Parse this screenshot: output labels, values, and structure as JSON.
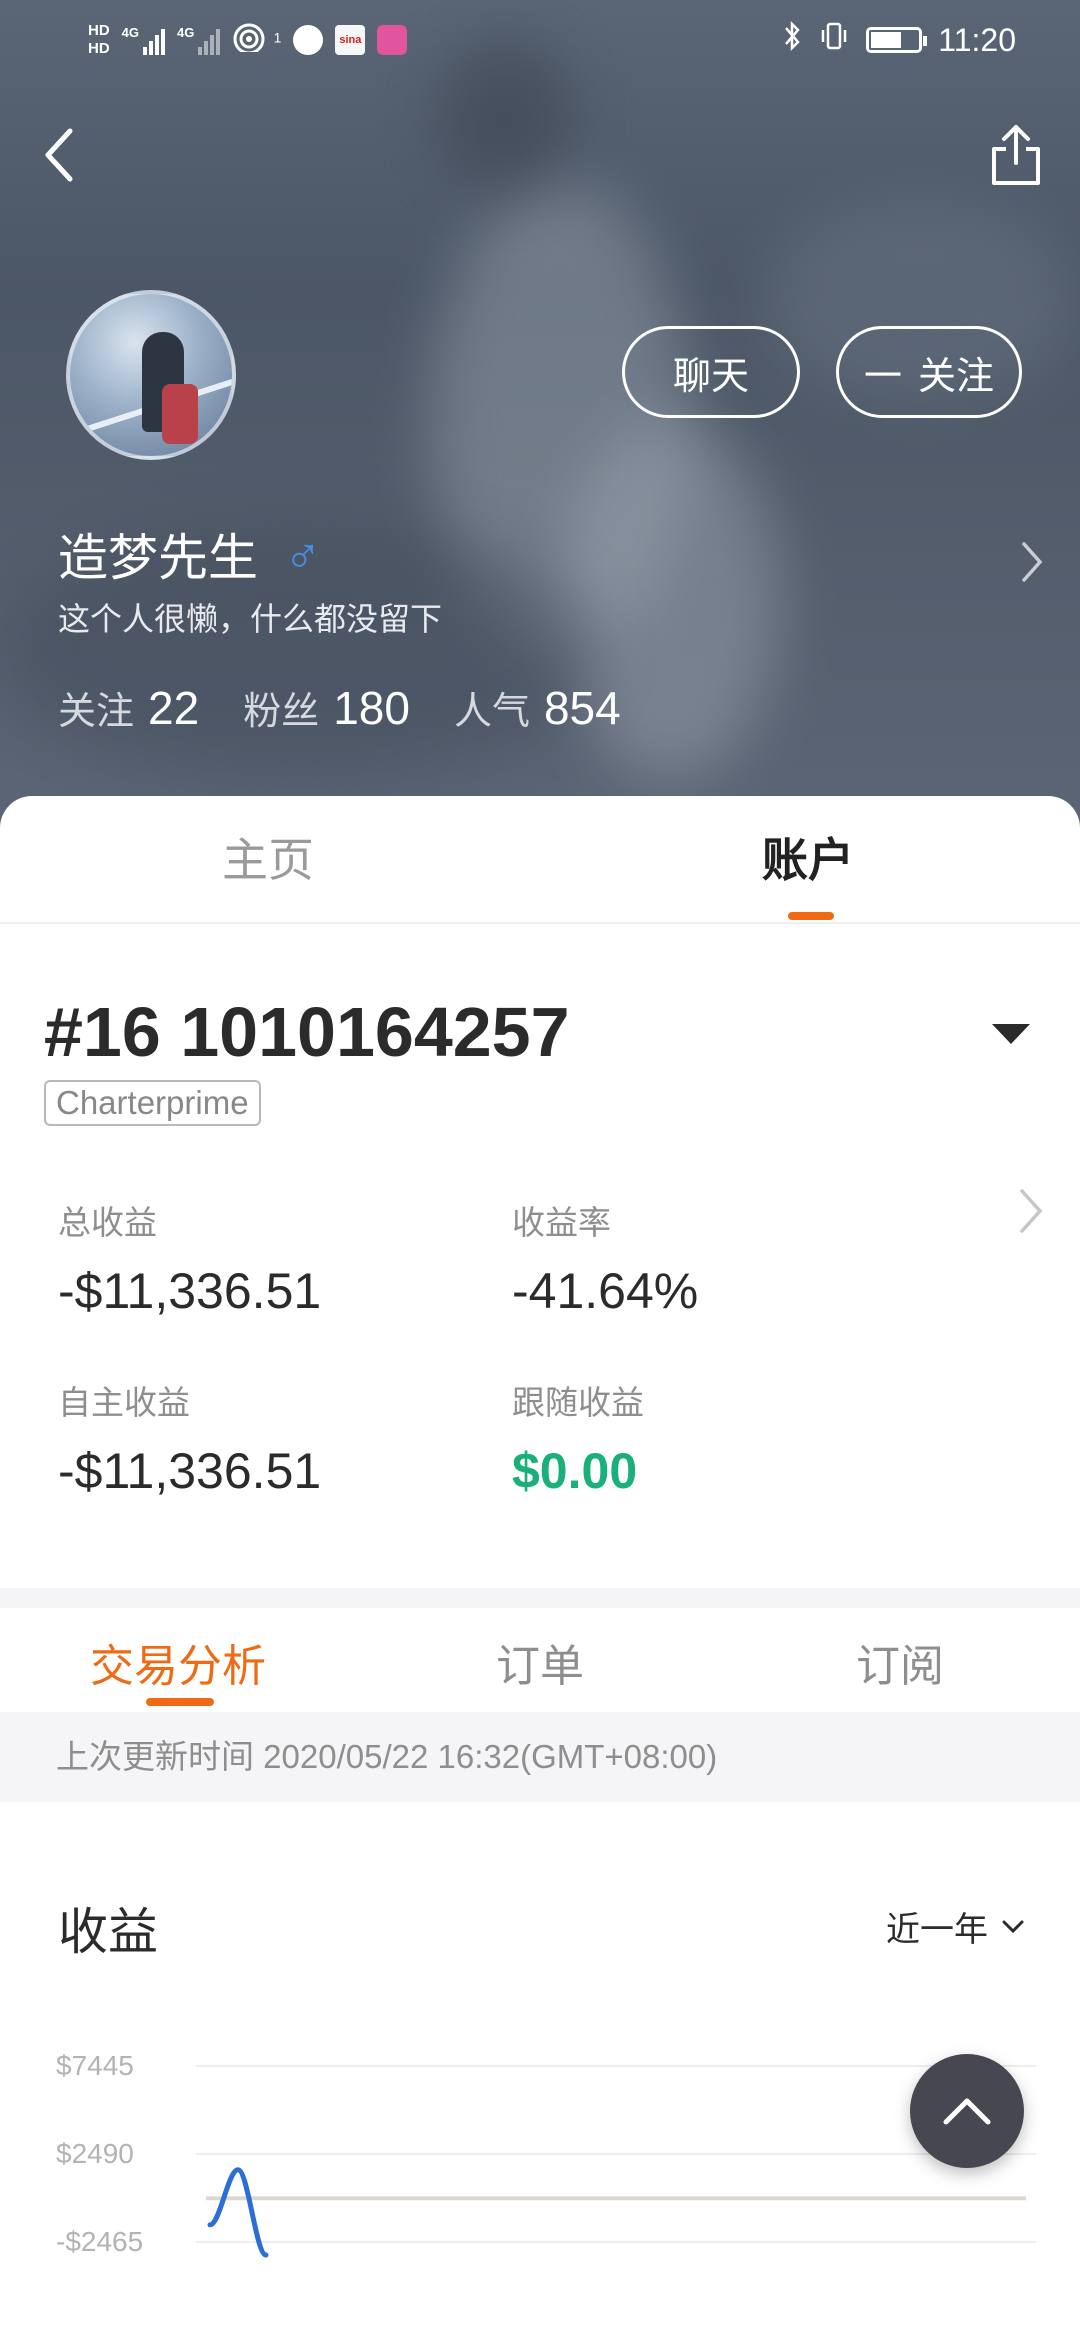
{
  "status_bar": {
    "hd1": "HD",
    "hd2": "HD",
    "net1": "4G",
    "net2": "4G",
    "wifi_badge": "1",
    "sina_label": "sina",
    "time": "11:20",
    "icons": [
      "signal-icon",
      "wifi-icon",
      "globe-icon",
      "sina-weibo-icon",
      "app-icon",
      "bluetooth-icon",
      "vibrate-icon",
      "battery-icon"
    ]
  },
  "header": {
    "back_icon": "chevron-left-icon",
    "share_icon": "share-icon"
  },
  "profile": {
    "name": "造梦先生",
    "gender_symbol": "♂",
    "bio": "这个人很懒，什么都没留下",
    "chat_label": "聊天",
    "follow_label": "关注",
    "follow_icon_text": "一",
    "stats": [
      {
        "label": "关注",
        "value": "22"
      },
      {
        "label": "粉丝",
        "value": "180"
      },
      {
        "label": "人气",
        "value": "854"
      }
    ]
  },
  "tabs": {
    "home": "主页",
    "account": "账户",
    "active": "account"
  },
  "account": {
    "number": "#16 1010164257",
    "broker": "Charterprime",
    "metrics": [
      {
        "label": "总收益",
        "value": "-$11,336.51"
      },
      {
        "label": "收益率",
        "value": "-41.64%"
      },
      {
        "label": "自主收益",
        "value": "-$11,336.51"
      },
      {
        "label": "跟随收益",
        "value": "$0.00"
      }
    ]
  },
  "sub_tabs": {
    "analysis": "交易分析",
    "orders": "订单",
    "subscriptions": "订阅",
    "active": "analysis"
  },
  "update_text": "上次更新时间 2020/05/22 16:32(GMT+08:00)",
  "earnings": {
    "title": "收益",
    "range": "近一年"
  },
  "chart_data": {
    "type": "line",
    "y_ticks": [
      "$7445",
      "$2490",
      "-$2465"
    ],
    "y_tick_values": [
      7445,
      2490,
      -2465
    ],
    "baseline": 0,
    "series": [
      {
        "color": "#2b6fd6",
        "points": [
          [
            0,
            -1500
          ],
          [
            1,
            1600
          ],
          [
            2,
            -3200
          ]
        ]
      }
    ],
    "grid": true
  },
  "colors": {
    "accent": "#f06a14",
    "positive": "#19b07a",
    "line": "#2b6fd6"
  }
}
